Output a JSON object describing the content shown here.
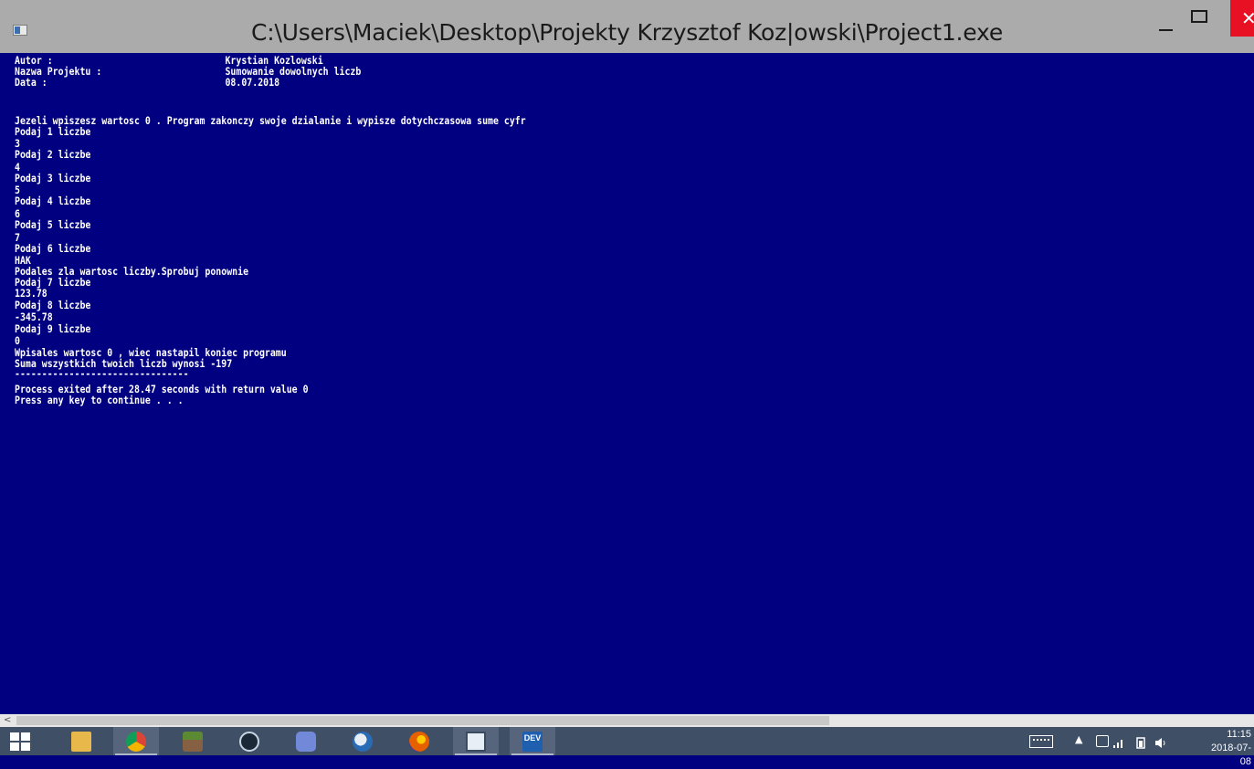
{
  "window": {
    "title": "C:\\Users\\Maciek\\Desktop\\Projekty Krzysztof Koz|owski\\Project1.exe",
    "minimize_glyph": "",
    "maximize_glyph": "",
    "close_glyph": "✕"
  },
  "console": {
    "header": [
      {
        "label": "Autor :",
        "value": "Krystian Kozlowski"
      },
      {
        "label": "Nazwa Projektu :",
        "value": "Sumowanie dowolnych liczb"
      },
      {
        "label": "Data :",
        "value": "08.07.2018"
      }
    ],
    "lines": [
      "Jezeli wpiszesz wartosc 0 . Program zakonczy swoje dzialanie i wypisze dotychczasowa sume cyfr",
      "Podaj 1 liczbe",
      "3",
      "Podaj 2 liczbe",
      "4",
      "Podaj 3 liczbe",
      "5",
      "Podaj 4 liczbe",
      "6",
      "Podaj 5 liczbe",
      "7",
      "Podaj 6 liczbe",
      "HAK",
      "Podales zla wartosc liczby.Sprobuj ponownie",
      "Podaj 7 liczbe",
      "123.78",
      "Podaj 8 liczbe",
      "-345.78",
      "Podaj 9 liczbe",
      "0",
      "Wpisales wartosc 0 , wiec nastapil koniec programu",
      "Suma wszystkich twoich liczb wynosi -197",
      "--------------------------------",
      "Process exited after 28.47 seconds with return value 0",
      "Press any key to continue . . ."
    ]
  },
  "scrollbar": {
    "left_arrow": "<"
  },
  "taskbar": {
    "apps": [
      {
        "name": "file-explorer",
        "color": "#e8b84a"
      },
      {
        "name": "chrome",
        "color": "#db4437"
      },
      {
        "name": "minecraft",
        "color": "#5b8a32"
      },
      {
        "name": "steam",
        "color": "#1b2838"
      },
      {
        "name": "discord",
        "color": "#7289da"
      },
      {
        "name": "thunderbird",
        "color": "#2a6bb5"
      },
      {
        "name": "firefox",
        "color": "#e66000"
      },
      {
        "name": "console-window",
        "color": "#e8eef5"
      },
      {
        "name": "dev-cpp",
        "color": "#1f5fb0",
        "label": "DEV"
      }
    ],
    "tray": {
      "arrow": "▲",
      "time": "11:15",
      "date": "2018-07-08"
    }
  }
}
